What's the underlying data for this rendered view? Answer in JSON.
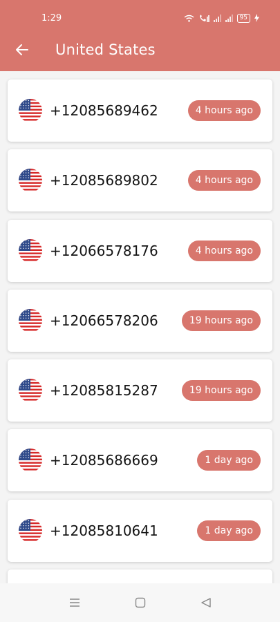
{
  "theme": {
    "accent": "#d8766d"
  },
  "status_bar": {
    "time": "1:29",
    "battery": "95",
    "icons": [
      "wifi-icon",
      "call-icon",
      "signal-icon",
      "signal-icon",
      "battery-icon",
      "charging-icon"
    ]
  },
  "header": {
    "back_icon": "arrow-left-icon",
    "title": "United States"
  },
  "numbers": [
    {
      "phone": "+12085689462",
      "time_ago": "4 hours ago",
      "flag": "us-flag-icon"
    },
    {
      "phone": "+12085689802",
      "time_ago": "4 hours ago",
      "flag": "us-flag-icon"
    },
    {
      "phone": "+12066578176",
      "time_ago": "4 hours ago",
      "flag": "us-flag-icon"
    },
    {
      "phone": "+12066578206",
      "time_ago": "19 hours ago",
      "flag": "us-flag-icon"
    },
    {
      "phone": "+12085815287",
      "time_ago": "19 hours ago",
      "flag": "us-flag-icon"
    },
    {
      "phone": "+12085686669",
      "time_ago": "1 day ago",
      "flag": "us-flag-icon"
    },
    {
      "phone": "+12085810641",
      "time_ago": "1 day ago",
      "flag": "us-flag-icon"
    }
  ],
  "nav_bar": {
    "icons": [
      "menu-icon",
      "home-icon",
      "back-triangle-icon"
    ]
  }
}
